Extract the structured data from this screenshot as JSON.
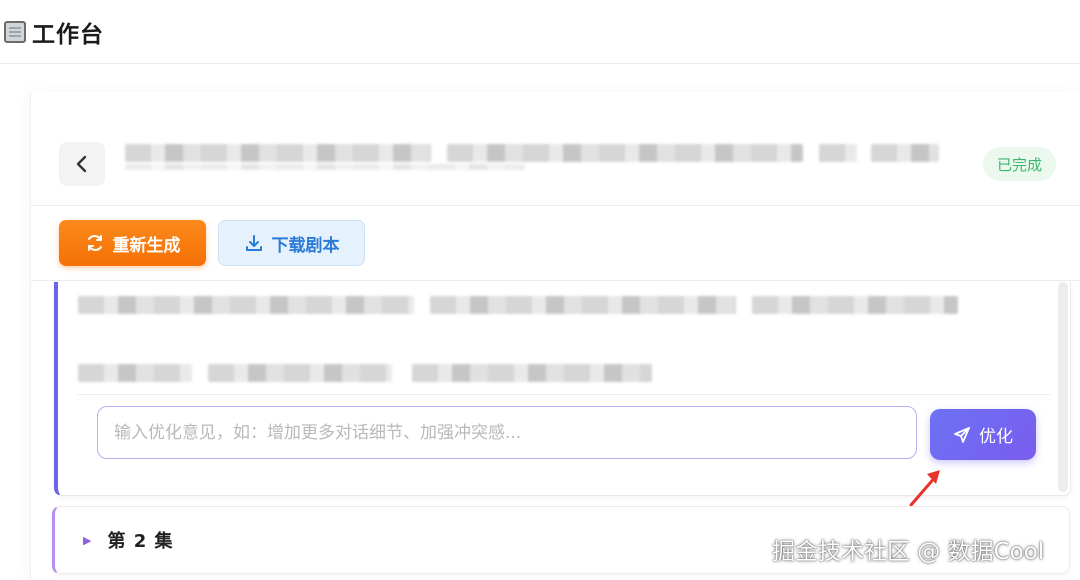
{
  "app": {
    "title": "工作台",
    "icon": "notebook-icon"
  },
  "header": {
    "back_icon": "chevron-left-icon",
    "status": "已完成",
    "status_color": "#3cb76a"
  },
  "actions": {
    "regenerate_label": "重新生成",
    "regenerate_icon": "refresh-icon",
    "download_label": "下载剧本",
    "download_icon": "download-icon",
    "regenerate_color": "#f57006",
    "download_color": "#2a7bd8"
  },
  "feedback": {
    "placeholder": "输入优化意见，如：增加更多对话细节、加强冲突感...",
    "value": "",
    "submit_label": "优化",
    "submit_icon": "send-icon",
    "accent": "#6d63e8"
  },
  "episodes": [
    {
      "label": "第 2 集",
      "icon": "triangle-right-icon"
    }
  ],
  "watermark": "掘金技术社区 @ 数据Cool"
}
